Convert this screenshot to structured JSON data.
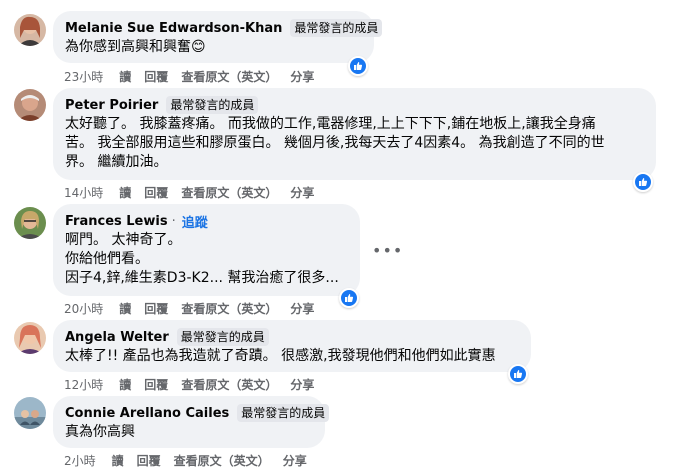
{
  "comments": [
    {
      "name": "Melanie Sue Edwardson-Khan",
      "badge": "最常發言的成員",
      "lines": [
        "為你感到高興和興奮😊"
      ],
      "time": "23小時",
      "actions": [
        "讀",
        "回覆",
        "查看原文（英文）",
        "分享"
      ],
      "avatar_color": "#a8553a"
    },
    {
      "name": "Peter Poirier",
      "badge": "最常發言的成員",
      "lines": [
        "太好聽了。 我膝蓋疼痛。 而我做的工作,電器修理,上上下下下,鋪在地板上,讓我全身痛",
        "苦。 我全部服用這些和膠原蛋白。 幾個月後,我每天去了4因素4。 為我創造了不同的世",
        "界。 繼續加油。"
      ],
      "time": "14小時",
      "actions": [
        "讀",
        "回覆",
        "查看原文（英文）",
        "分享"
      ],
      "avatar_color": "#7a3e2a"
    },
    {
      "name": "Frances Lewis",
      "follow": "追蹤",
      "lines": [
        "啊門。 太神奇了。",
        "你給他們看。",
        "因子4,鋅,維生素D3-K2... 幫我治癒了很多..."
      ],
      "time": "20小時",
      "actions": [
        "讀",
        "回覆",
        "查看原文（英文）",
        "分享"
      ],
      "more": "•••",
      "avatar_color": "#c7a86a"
    },
    {
      "name": "Angela Welter",
      "badge": "最常發言的成員",
      "lines": [
        "太棒了!! 產品也為我造就了奇蹟。 很感激,我發現他們和他們如此實惠"
      ],
      "time": "12小時",
      "actions": [
        "讀",
        "回覆",
        "查看原文（英文）",
        "分享"
      ],
      "avatar_color": "#d9745a"
    },
    {
      "name": "Connie Arellano Cailes",
      "badge": "最常發言的成員",
      "lines": [
        "真為你高興"
      ],
      "time": "2小時",
      "actions": [
        "讀",
        "回覆",
        "查看原文（英文）",
        "分享"
      ],
      "avatar_color": "#6f8a9c"
    }
  ],
  "colors": {
    "bubble": "#f0f2f5",
    "like": "#1877f2",
    "meta": "#65676b",
    "link": "#1b74e4"
  }
}
